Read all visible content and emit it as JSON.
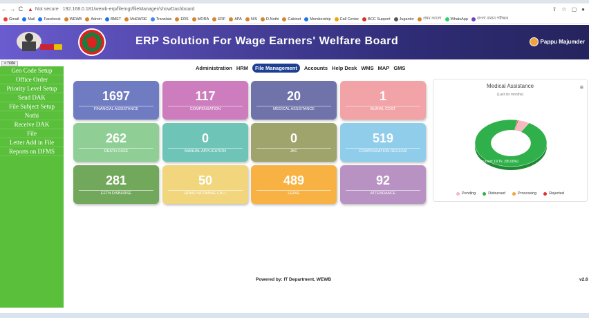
{
  "browser": {
    "security_text": "Not secure",
    "url": "192.168.0.181/wewb-erp/filemgt/fileManager/showDashboard",
    "bookmarks": [
      "Gmail",
      "Mail",
      "Facebook",
      "WEWB",
      "Admin",
      "BMET",
      "MoEWOE",
      "Translate",
      "ERS",
      "MORA",
      "ERF",
      "APA",
      "NIS",
      "D.Nothi",
      "Cabinet",
      "Membership",
      "Call Center",
      "BCC Support",
      "Jugantor",
      "প্রথম আলো",
      "WhatsApp",
      "বাংলা বানান পরীক্ষক"
    ]
  },
  "header": {
    "title": "ERP Solution For Wage Earners' Welfare Board",
    "user_name": "Pappu Majumder"
  },
  "hide_label": "« hide",
  "sidebar": {
    "items": [
      "Geo Code Setup",
      "Office Order",
      "Priority Level Setup",
      "Send DAK",
      "File Subject Setup",
      "Nothi",
      "Receive DAK",
      "File",
      "Letter Add in File",
      "Reports on DFMS"
    ]
  },
  "menu": [
    "Administration",
    "HRM",
    "File Management",
    "Accounts",
    "Help Desk",
    "WMS",
    "MAP",
    "GMS"
  ],
  "tiles": [
    {
      "value": "1697",
      "label": "Financial Assistance",
      "color": "#6f7cc2"
    },
    {
      "value": "117",
      "label": "Compensation",
      "color": "#cd7dbd"
    },
    {
      "value": "20",
      "label": "Medical Assistance",
      "color": "#6f73a9"
    },
    {
      "value": "1",
      "label": "Burial Cost",
      "color": "#f2a3a7"
    },
    {
      "value": "262",
      "label": "Death Case",
      "color": "#8fcf96"
    },
    {
      "value": "0",
      "label": "Manual Application",
      "color": "#6ec4b6"
    },
    {
      "value": "0",
      "label": "JBC",
      "color": "#9fa36c"
    },
    {
      "value": "519",
      "label": "Compensation Receive",
      "color": "#8fcdea"
    },
    {
      "value": "281",
      "label": "EFTN Disburse",
      "color": "#72a85b"
    },
    {
      "value": "50",
      "label": "HDMS Incoming Call",
      "color": "#f1d67e"
    },
    {
      "value": "489",
      "label": "Leave",
      "color": "#f7b243"
    },
    {
      "value": "92",
      "label": "Attendance",
      "color": "#b892c3"
    }
  ],
  "chart_data": {
    "type": "pie",
    "title": "Medical Assistance",
    "subtitle": "(Last six months)",
    "categories": [
      "Pending",
      "Disbursed",
      "Processing",
      "Rejected"
    ],
    "values": [
      1,
      19,
      0,
      0.1
    ],
    "colors": [
      "#f4b8c0",
      "#2fb04a",
      "#f2a33a",
      "#e52d2d"
    ],
    "annotation": "Disbursed: 19 Tk. (95.00%)",
    "legend_position": "bottom"
  },
  "footer": {
    "text": "Powered by: IT Department, WEWB",
    "version": "v2.6"
  }
}
